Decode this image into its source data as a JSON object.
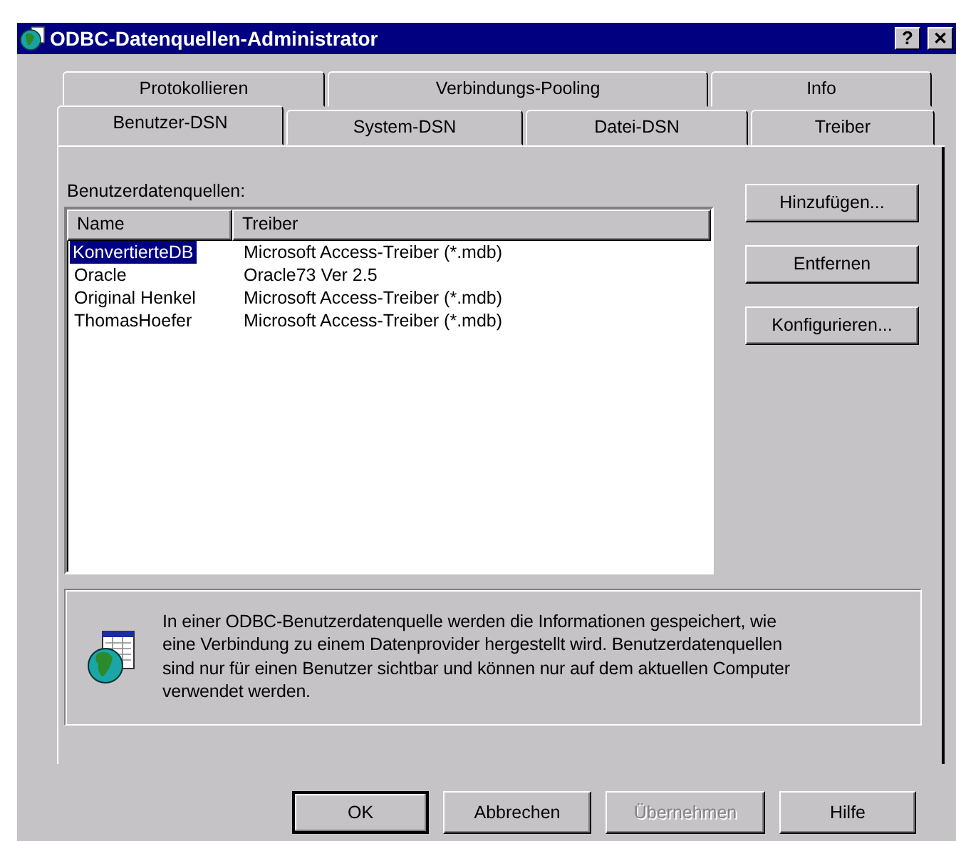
{
  "window": {
    "title": "ODBC-Datenquellen-Administrator",
    "title_buttons": [
      {
        "kind": "help",
        "label": "?"
      },
      {
        "kind": "close",
        "label": "✕"
      }
    ]
  },
  "tab_rows": [
    [
      {
        "label": "Protokollieren",
        "selected": false
      },
      {
        "label": "Verbindungs-Pooling",
        "selected": false
      },
      {
        "label": "Info",
        "selected": false
      }
    ],
    [
      {
        "label": "Benutzer-DSN",
        "selected": true
      },
      {
        "label": "System-DSN",
        "selected": false
      },
      {
        "label": "Datei-DSN",
        "selected": false
      },
      {
        "label": "Treiber",
        "selected": false
      }
    ]
  ],
  "list_label": {
    "text": "Benutzerdatenquellen:"
  },
  "table": {
    "columns": [
      "Name",
      "Treiber"
    ],
    "rows": [
      {
        "cells": [
          "KonvertierteDB",
          "Microsoft Access-Treiber (*.mdb)"
        ],
        "selected": true
      },
      {
        "cells": [
          "Oracle",
          "Oracle73 Ver 2.5"
        ],
        "selected": false
      },
      {
        "cells": [
          "Original Henkel",
          "Microsoft Access-Treiber (*.mdb)"
        ],
        "selected": false
      },
      {
        "cells": [
          "ThomasHoefer",
          "Microsoft Access-Treiber (*.mdb)"
        ],
        "selected": false
      }
    ]
  },
  "side_buttons": [
    {
      "label": "Hinzufügen..."
    },
    {
      "label": "Entfernen"
    },
    {
      "label": "Konfigurieren..."
    }
  ],
  "info": "In einer ODBC-Benutzerdatenquelle werden die Informationen gespeichert, wie eine Verbindung zu einem Datenprovider hergestellt wird. Benutzerdatenquellen sind nur für einen Benutzer sichtbar und können nur auf dem aktuellen Computer verwendet werden.",
  "buttons": [
    {
      "label": "OK",
      "default": true,
      "disabled": false
    },
    {
      "label": "Abbrechen",
      "default": false,
      "disabled": false
    },
    {
      "label": "Übernehmen",
      "default": false,
      "disabled": true
    },
    {
      "label": "Hilfe",
      "default": false,
      "disabled": false
    }
  ]
}
